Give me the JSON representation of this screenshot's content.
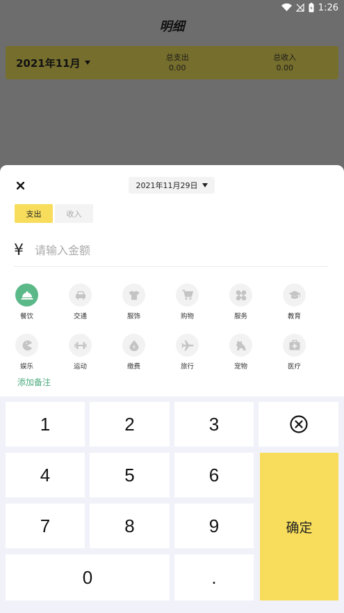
{
  "status_bar": {
    "time": "1:26"
  },
  "page": {
    "title": "明细",
    "month": "2021年11月",
    "total_expense_label": "总支出",
    "total_expense_value": "0.00",
    "total_income_label": "总收入",
    "total_income_value": "0.00"
  },
  "sheet": {
    "date": "2021年11月29日",
    "tabs": [
      {
        "label": "支出",
        "active": true
      },
      {
        "label": "收入",
        "active": false
      }
    ],
    "currency_symbol": "¥",
    "amount_placeholder": "请输入金额",
    "categories": [
      {
        "label": "餐饮",
        "icon": "dining-icon",
        "selected": true
      },
      {
        "label": "交通",
        "icon": "car-icon"
      },
      {
        "label": "服饰",
        "icon": "shirt-icon"
      },
      {
        "label": "购物",
        "icon": "cart-icon"
      },
      {
        "label": "服务",
        "icon": "service-icon"
      },
      {
        "label": "教育",
        "icon": "graduation-cap-icon"
      },
      {
        "label": "娱乐",
        "icon": "pacman-icon"
      },
      {
        "label": "运动",
        "icon": "dumbbell-icon"
      },
      {
        "label": "缴费",
        "icon": "droplet-icon"
      },
      {
        "label": "旅行",
        "icon": "airplane-icon"
      },
      {
        "label": "宠物",
        "icon": "pet-icon"
      },
      {
        "label": "医疗",
        "icon": "medical-kit-icon"
      }
    ],
    "remark_label": "添加备注"
  },
  "keypad": {
    "k1": "1",
    "k2": "2",
    "k3": "3",
    "k4": "4",
    "k5": "5",
    "k6": "6",
    "k7": "7",
    "k8": "8",
    "k9": "9",
    "k0": "0",
    "dot": ".",
    "delete_icon": "backspace-circle-icon",
    "confirm": "确定"
  },
  "colors": {
    "accent_yellow": "#f7dd5b",
    "accent_green": "#5bb889",
    "keypad_bg": "#f1f2f9"
  }
}
